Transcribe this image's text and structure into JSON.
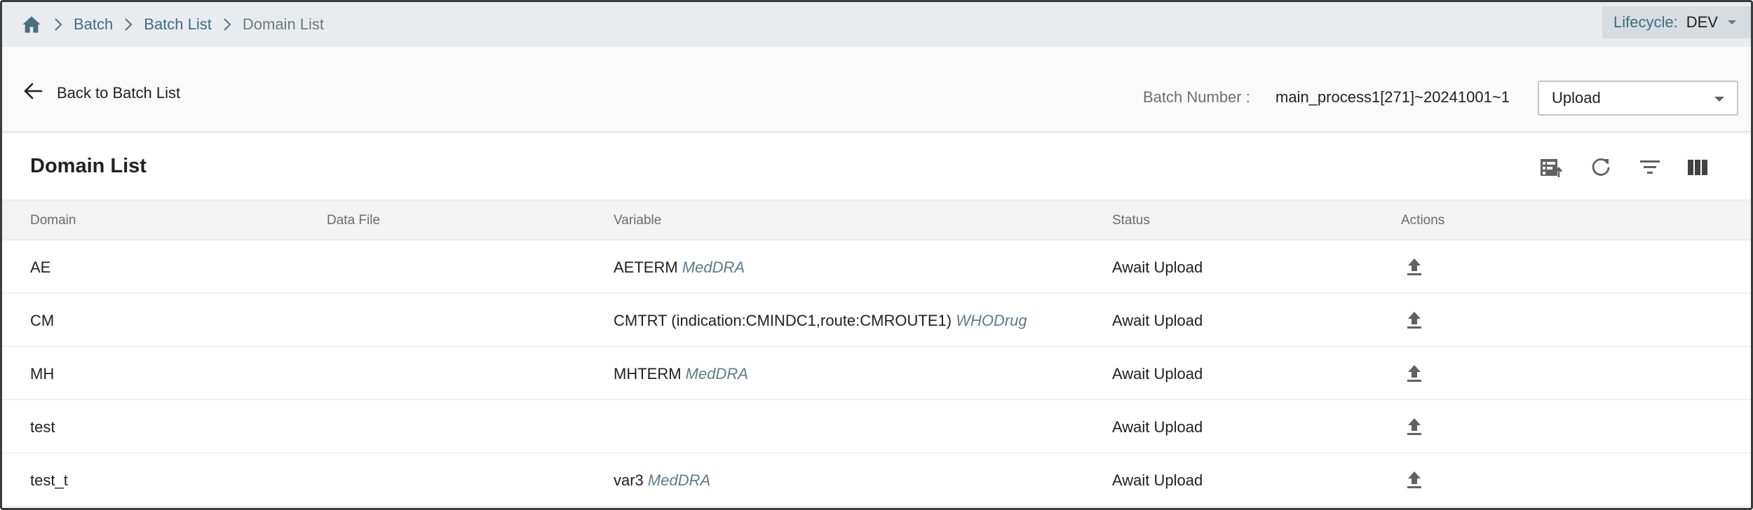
{
  "breadcrumb": {
    "items": [
      {
        "label": "Batch"
      },
      {
        "label": "Batch List"
      }
    ],
    "current": "Domain List"
  },
  "lifecycle": {
    "label": "Lifecycle:",
    "value": "DEV"
  },
  "toolbar": {
    "back_label": "Back to Batch List",
    "batch_number_label": "Batch Number :",
    "batch_number_value": "main_process1[271]~20241001~1",
    "action_select_value": "Upload"
  },
  "table": {
    "title": "Domain List",
    "columns": [
      "Domain",
      "Data File",
      "Variable",
      "Status",
      "Actions"
    ],
    "rows": [
      {
        "domain": "AE",
        "data_file": "",
        "variable": "AETERM",
        "dictionary": "MedDRA",
        "status": "Await Upload"
      },
      {
        "domain": "CM",
        "data_file": "",
        "variable": "CMTRT (indication:CMINDC1,route:CMROUTE1)",
        "dictionary": "WHODrug",
        "status": "Await Upload"
      },
      {
        "domain": "MH",
        "data_file": "",
        "variable": "MHTERM",
        "dictionary": "MedDRA",
        "status": "Await Upload"
      },
      {
        "domain": "test",
        "data_file": "",
        "variable": "",
        "dictionary": "",
        "status": "Await Upload"
      },
      {
        "domain": "test_t",
        "data_file": "",
        "variable": "var3",
        "dictionary": "MedDRA",
        "status": "Await Upload"
      }
    ]
  },
  "icons": {
    "home": "home-icon",
    "chevron": "chevron-right-icon",
    "back": "arrow-left-icon",
    "import": "import-file-icon",
    "refresh": "refresh-icon",
    "filter": "filter-icon",
    "columns": "columns-icon",
    "upload": "upload-icon"
  },
  "colors": {
    "link": "#3d6f84",
    "dictionary": "#5b7d8c",
    "breadcrumb_bg": "#e9ecee"
  }
}
